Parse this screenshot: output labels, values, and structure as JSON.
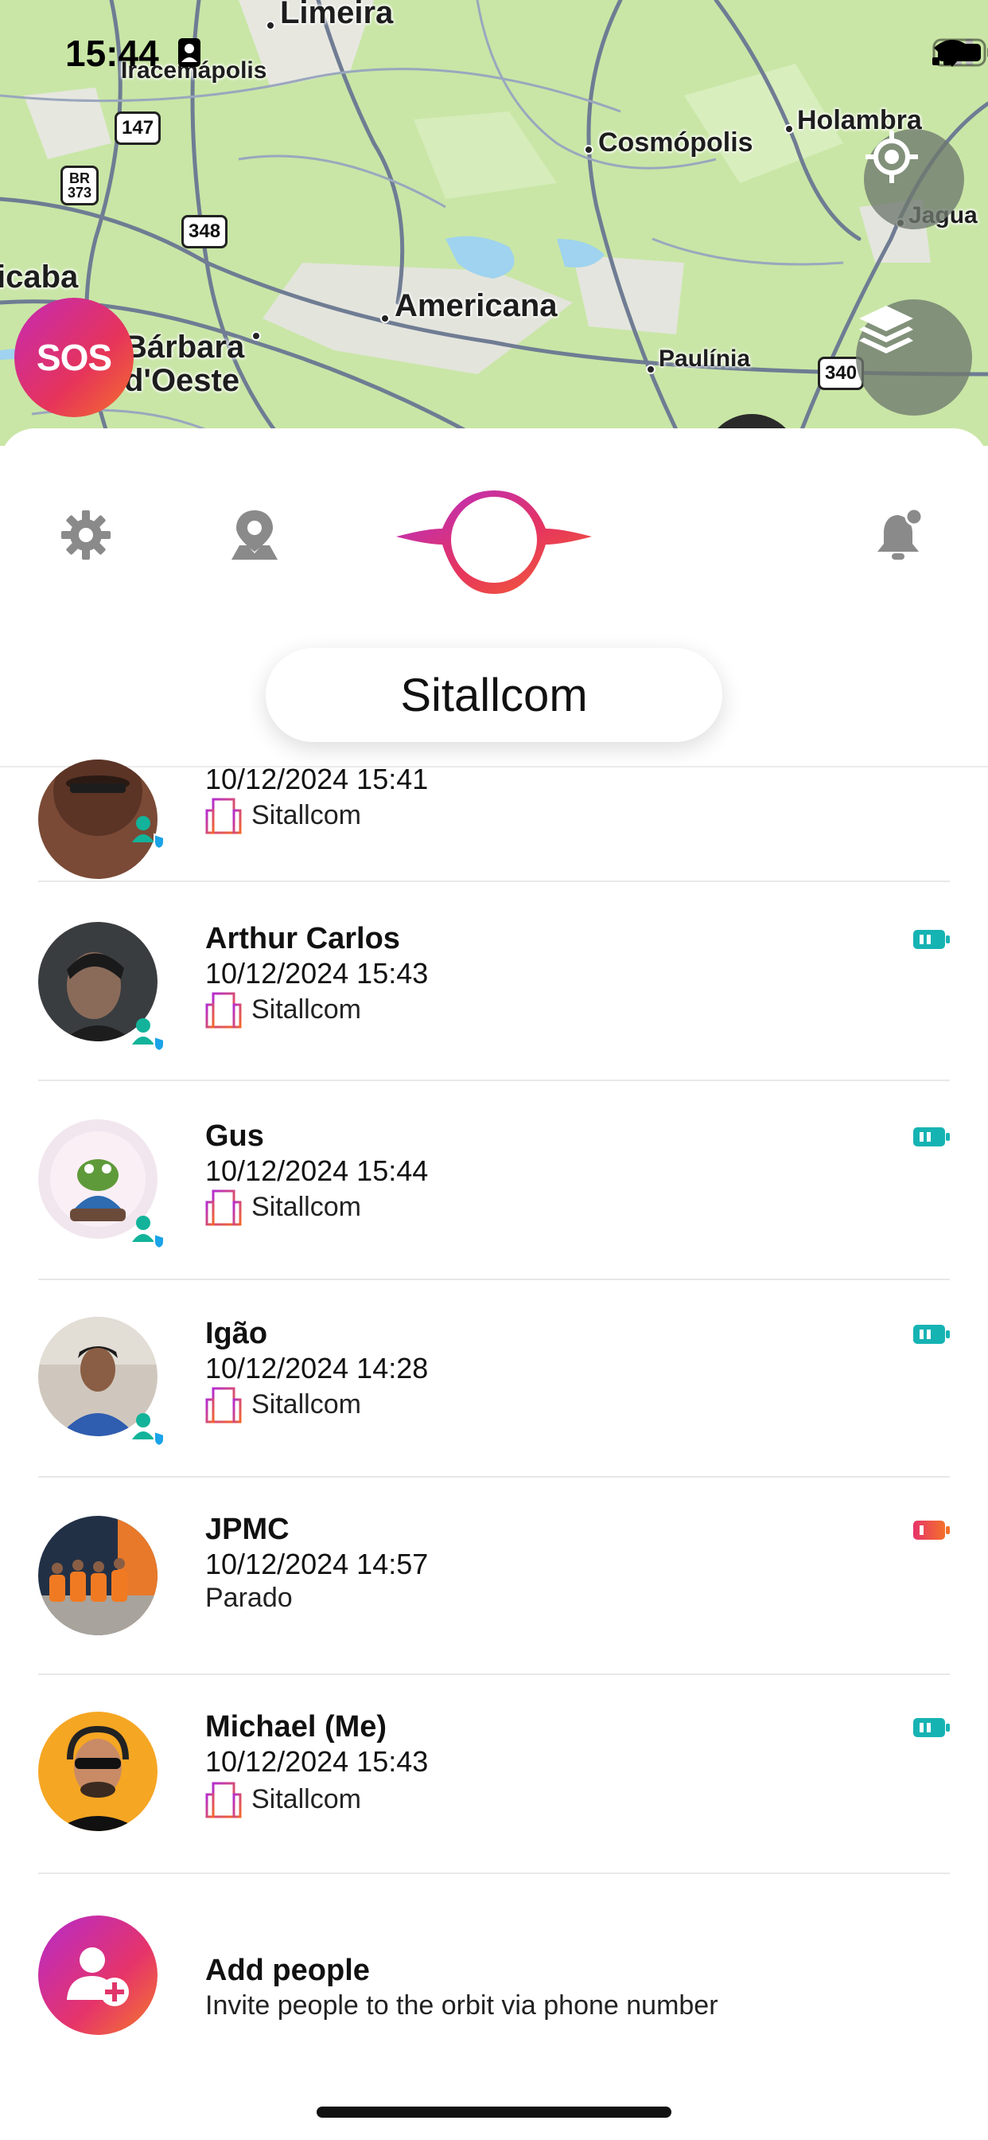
{
  "status_bar": {
    "time": "15:44"
  },
  "map": {
    "labels": {
      "limeira": "Limeira",
      "iracemapolis": "Iracemápolis",
      "cosmopolis": "Cosmópolis",
      "holambra": "Holambra",
      "jagua": "Jagua",
      "icaba": "icaba",
      "barbara": "Bárbara",
      "doeste": "d'Oeste",
      "americana": "Americana",
      "paulinia": "Paulínia"
    },
    "shields": {
      "r147": "147",
      "br373_top": "BR",
      "br373_bottom": "373",
      "r348": "348",
      "r340": "340"
    },
    "sos_label": "SOS"
  },
  "header": {
    "circle_name": "Sitallcom"
  },
  "members": [
    {
      "name": "",
      "timestamp": "10/12/2024 15:41",
      "place": "Sitallcom",
      "battery": "teal"
    },
    {
      "name": "Arthur Carlos",
      "timestamp": "10/12/2024 15:43",
      "place": "Sitallcom",
      "battery": "teal"
    },
    {
      "name": "Gus",
      "timestamp": "10/12/2024 15:44",
      "place": "Sitallcom",
      "battery": "teal"
    },
    {
      "name": "Igão",
      "timestamp": "10/12/2024 14:28",
      "place": "Sitallcom",
      "battery": "teal"
    },
    {
      "name": "JPMC",
      "timestamp": "10/12/2024 14:57",
      "place": "Parado",
      "battery": "red"
    },
    {
      "name": "Michael (Me)",
      "timestamp": "10/12/2024 15:43",
      "place": "Sitallcom",
      "battery": "teal"
    }
  ],
  "add_people": {
    "title": "Add people",
    "subtitle": "Invite people to the orbit via phone number"
  },
  "colors": {
    "brand_gradient_start": "#c42ab5",
    "brand_gradient_end": "#f4702a",
    "battery_teal": "#16b3b3",
    "battery_red": "#f0405a",
    "badge_teal": "#12b39a",
    "badge_blue": "#1aa3e8"
  }
}
